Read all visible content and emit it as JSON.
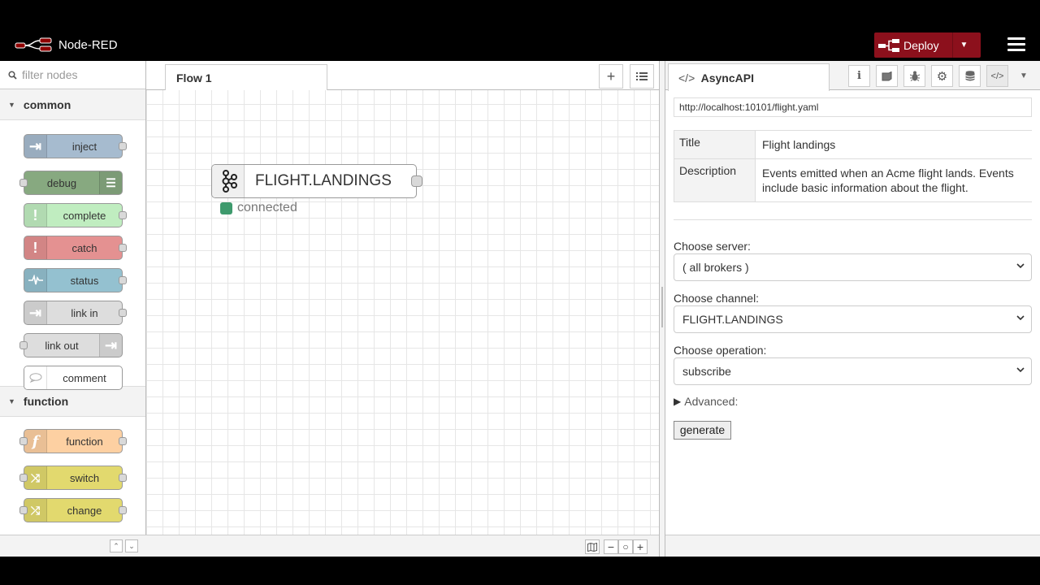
{
  "app": {
    "name": "Node-RED"
  },
  "header": {
    "deploy_label": "Deploy"
  },
  "palette": {
    "filter_placeholder": "filter nodes",
    "categories": [
      {
        "name": "common",
        "nodes": [
          "inject",
          "debug",
          "complete",
          "catch",
          "status",
          "link in",
          "link out",
          "comment"
        ]
      },
      {
        "name": "function",
        "nodes": [
          "function",
          "switch",
          "change"
        ]
      }
    ]
  },
  "workspace": {
    "tabs": [
      {
        "label": "Flow 1"
      }
    ],
    "node": {
      "label": "FLIGHT.LANDINGS",
      "status": "connected",
      "status_color": "#3e9a6d"
    }
  },
  "sidebar": {
    "tab_label": "AsyncAPI",
    "url": "http://localhost:10101/flight.yaml",
    "info": [
      {
        "key": "Title",
        "value": "Flight landings"
      },
      {
        "key": "Description",
        "value": "Events emitted when an Acme flight lands. Events include basic information about the flight."
      }
    ],
    "server": {
      "label": "Choose server:",
      "value": "( all brokers )"
    },
    "channel": {
      "label": "Choose channel:",
      "value": "FLIGHT.LANDINGS"
    },
    "operation": {
      "label": "Choose operation:",
      "value": "subscribe"
    },
    "advanced_label": "Advanced:",
    "generate_label": "generate"
  },
  "colors": {
    "deploy": "#8c101c",
    "inject": "#a6bbcf",
    "debug": "#87a980",
    "complete": "#c0edc0",
    "catch": "#e49191",
    "status": "#94c1d0",
    "link": "#dddddd",
    "function": "#fdd0a2",
    "switch": "#e2d96e",
    "change": "#e2d96e"
  }
}
